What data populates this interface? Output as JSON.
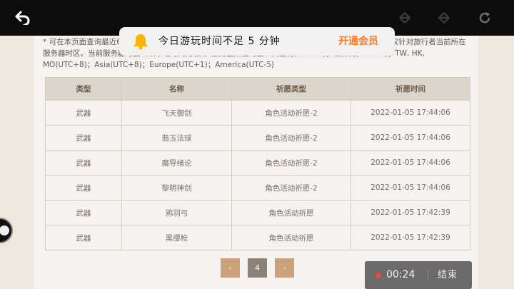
{
  "notice": "* 可在本页面查询最近6个月的祈愿记录。若无记录请稍后查询。若无法查询，请稍后再试。以下祈愿时间仅针对旅行者当前所在服务器时区。当前服务器时区（以本地时间为准）。服务器所在时区：天空岛(UTC+8)；世界树(UTC+8)；TW, HK, MO(UTC+8)；Asia(UTC+8)；Europe(UTC+1)；America(UTC-5)",
  "table": {
    "headers": [
      "类型",
      "名称",
      "祈愿类型",
      "祈愿时间"
    ],
    "rows": [
      [
        "武器",
        "飞天御剑",
        "角色活动祈愿-2",
        "2022-01-05 17:44:06"
      ],
      [
        "武器",
        "翡玉法球",
        "角色活动祈愿-2",
        "2022-01-05 17:44:06"
      ],
      [
        "武器",
        "魔导绪论",
        "角色活动祈愿-2",
        "2022-01-05 17:44:06"
      ],
      [
        "武器",
        "黎明神剑",
        "角色活动祈愿-2",
        "2022-01-05 17:44:06"
      ],
      [
        "武器",
        "鸦羽弓",
        "角色活动祈愿",
        "2022-01-05 17:42:39"
      ],
      [
        "武器",
        "黑缨枪",
        "角色活动祈愿",
        "2022-01-05 17:42:39"
      ]
    ]
  },
  "pager": {
    "prev": "‹",
    "current": "4",
    "next": "›"
  },
  "banner": {
    "text": "今日游玩时间不足 5 分钟",
    "cta": "开通会员"
  },
  "timer": {
    "time": "00:24",
    "end": "结束"
  },
  "icons": {
    "back": "back-arrow-icon",
    "nav_back": "nav-back-icon",
    "nav_forward": "nav-forward-icon",
    "refresh": "refresh-icon",
    "bell": "bell-icon"
  },
  "colors": {
    "accent": "#ff7a1e",
    "pager_nav": "#caa27c",
    "pager_current": "#8d8276",
    "record_dot": "#e8473f"
  }
}
